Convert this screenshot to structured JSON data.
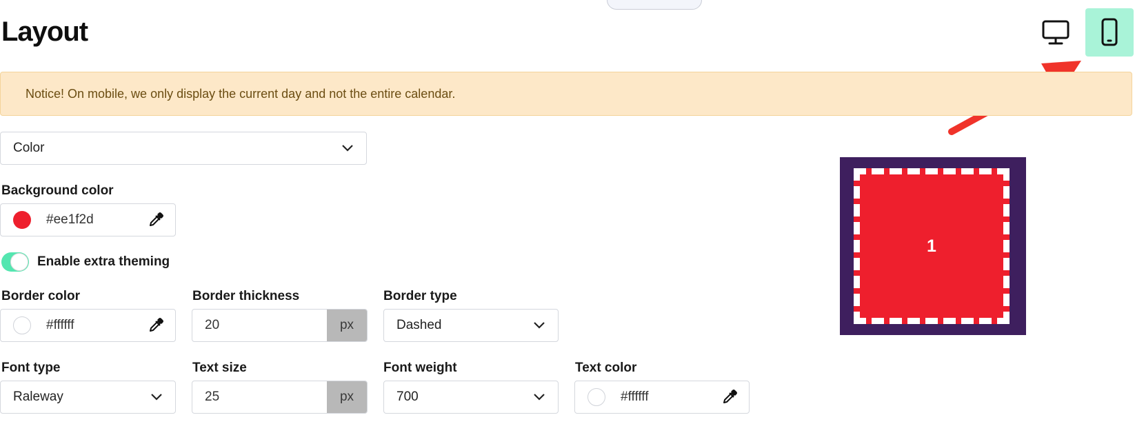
{
  "page": {
    "title": "Layout"
  },
  "view_toggle": {
    "desktop_icon": "desktop-monitor-icon",
    "mobile_icon": "mobile-phone-icon",
    "active": "mobile",
    "active_color": "#a9f3d8"
  },
  "annotation": {
    "arrow_color": "#f0332a"
  },
  "notice": {
    "text": "Notice! On mobile, we only display the current day and not the entire calendar."
  },
  "style_select": {
    "value": "Color"
  },
  "background": {
    "label": "Background color",
    "value": "#ee1f2d",
    "swatch": "#ee1f2d"
  },
  "extra_theming": {
    "label": "Enable extra theming",
    "enabled": true,
    "toggle_color": "#54e6b0"
  },
  "border_color": {
    "label": "Border color",
    "value": "#ffffff"
  },
  "border_thickness": {
    "label": "Border thickness",
    "value": "20",
    "unit": "px"
  },
  "border_type": {
    "label": "Border type",
    "value": "Dashed"
  },
  "font_type": {
    "label": "Font type",
    "value": "Raleway"
  },
  "text_size": {
    "label": "Text size",
    "value": "25",
    "unit": "px"
  },
  "font_weight": {
    "label": "Font weight",
    "value": "700"
  },
  "text_color": {
    "label": "Text color",
    "value": "#ffffff"
  },
  "preview": {
    "day": "1",
    "frame_color": "#3e1f5e",
    "day_color": "#ee1f2d",
    "border_color": "#ffffff"
  }
}
